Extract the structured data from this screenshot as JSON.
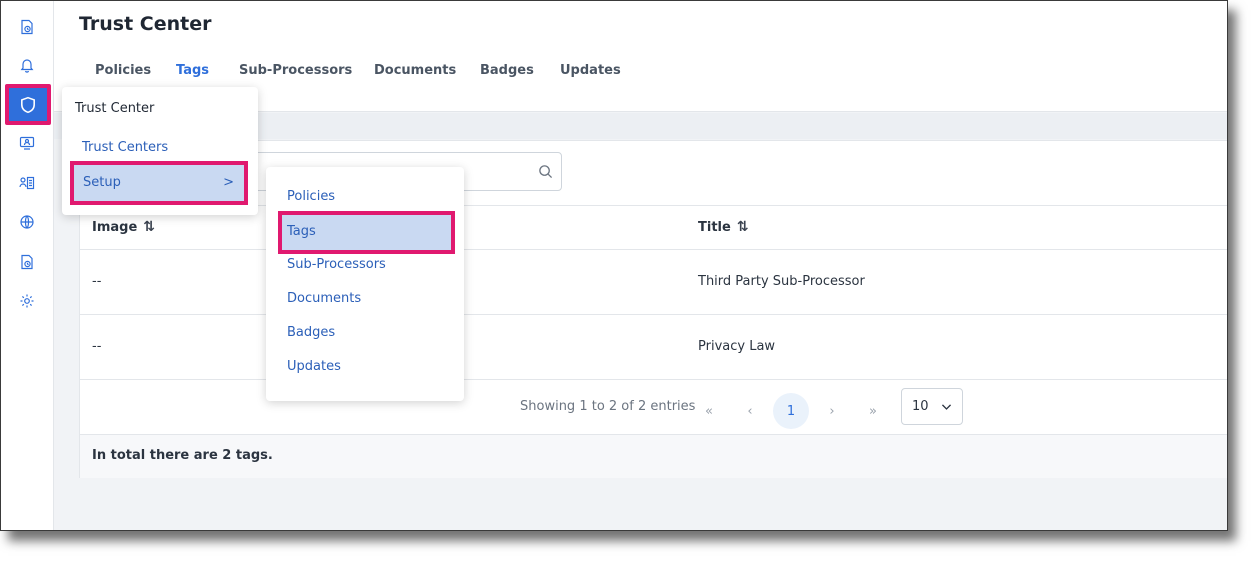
{
  "header": {
    "title": "Trust Center"
  },
  "tabs": [
    {
      "label": "Policies",
      "active": false
    },
    {
      "label": "Tags",
      "active": true
    },
    {
      "label": "Sub-Processors",
      "active": false
    },
    {
      "label": "Documents",
      "active": false
    },
    {
      "label": "Badges",
      "active": false
    },
    {
      "label": "Updates",
      "active": false
    }
  ],
  "sidebar": {
    "icons": [
      "document-clock-icon",
      "bell-icon",
      "shield-icon",
      "monitor-user-icon",
      "user-list-icon",
      "globe-cog-icon",
      "document-clock-icon",
      "gear-icon"
    ],
    "active_index": 2
  },
  "menu_primary": {
    "title": "Trust Center",
    "items": [
      "Trust Centers",
      "Setup"
    ],
    "submenu_arrow": ">"
  },
  "menu_setup": {
    "items": [
      "Policies",
      "Tags",
      "Sub-Processors",
      "Documents",
      "Badges",
      "Updates"
    ],
    "highlighted": "Tags"
  },
  "table": {
    "columns": [
      "Image",
      "Title"
    ],
    "sort_glyph": "⇅",
    "rows": [
      {
        "image": "--",
        "title": "Third Party Sub-Processor"
      },
      {
        "image": "--",
        "title": "Privacy Law"
      }
    ]
  },
  "pagination": {
    "showing": "Showing 1 to 2 of 2 entries",
    "first": "«",
    "prev": "‹",
    "current": "1",
    "next": "›",
    "last": "»",
    "per_page": "10"
  },
  "footer": {
    "total_text": "In total there are 2 tags."
  },
  "colors": {
    "accent": "#2f6fdb",
    "highlight_border": "#e0196f",
    "menu_highlight": "#c9d9f2"
  }
}
